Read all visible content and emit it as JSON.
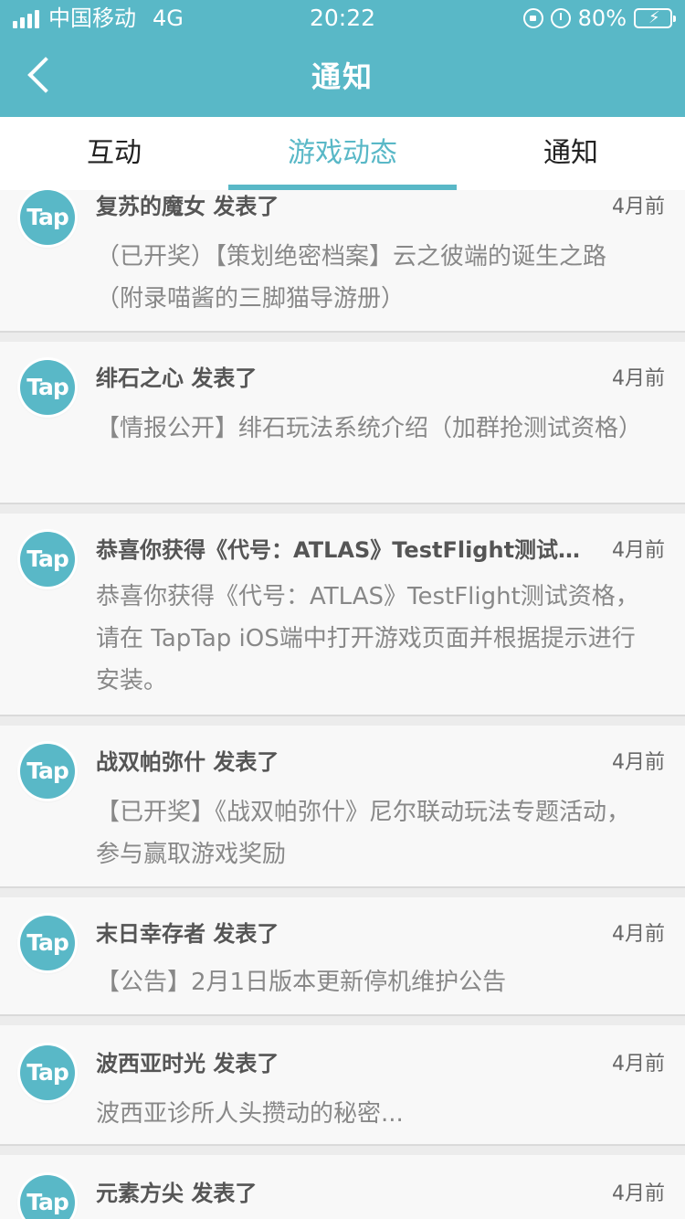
{
  "status_bar": {
    "carrier": "中国移动",
    "network": "4G",
    "time": "20:22",
    "battery_percent": "80%",
    "battery_level": 0.8
  },
  "nav": {
    "title": "通知",
    "back_icon": "chevron-left-icon"
  },
  "tabs": [
    {
      "label": "互动",
      "active": false
    },
    {
      "label": "游戏动态",
      "active": true
    },
    {
      "label": "通知",
      "active": false
    }
  ],
  "avatar_text": "Tap",
  "colors": {
    "accent": "#59b8c7",
    "card": "#f8f8f8",
    "divider": "#dadada"
  },
  "notifications": [
    {
      "sender": "复苏的魔女 发表了",
      "time": "4月前",
      "body": "（已开奖）【策划绝密档案】云之彼端的诞生之路（附录喵酱的三脚猫导游册）"
    },
    {
      "sender": "绯石之心 发表了",
      "time": "4月前",
      "body": "【情报公开】绯石玩法系统介绍（加群抢测试资格）"
    },
    {
      "sender": "恭喜你获得《代号：ATLAS》TestFlight测试…",
      "time": "4月前",
      "body": "恭喜你获得《代号：ATLAS》TestFlight测试资格，请在 TapTap iOS端中打开游戏页面并根据提示进行安装。"
    },
    {
      "sender": "战双帕弥什 发表了",
      "time": "4月前",
      "body": "【已开奖】《战双帕弥什》尼尔联动玩法专题活动，参与赢取游戏奖励"
    },
    {
      "sender": "末日幸存者 发表了",
      "time": "4月前",
      "body": "【公告】2月1日版本更新停机维护公告"
    },
    {
      "sender": "波西亚时光 发表了",
      "time": "4月前",
      "body": "波西亚诊所人头攒动的秘密..."
    },
    {
      "sender": "元素方尖 发表了",
      "time": "4月前",
      "body": ""
    }
  ]
}
